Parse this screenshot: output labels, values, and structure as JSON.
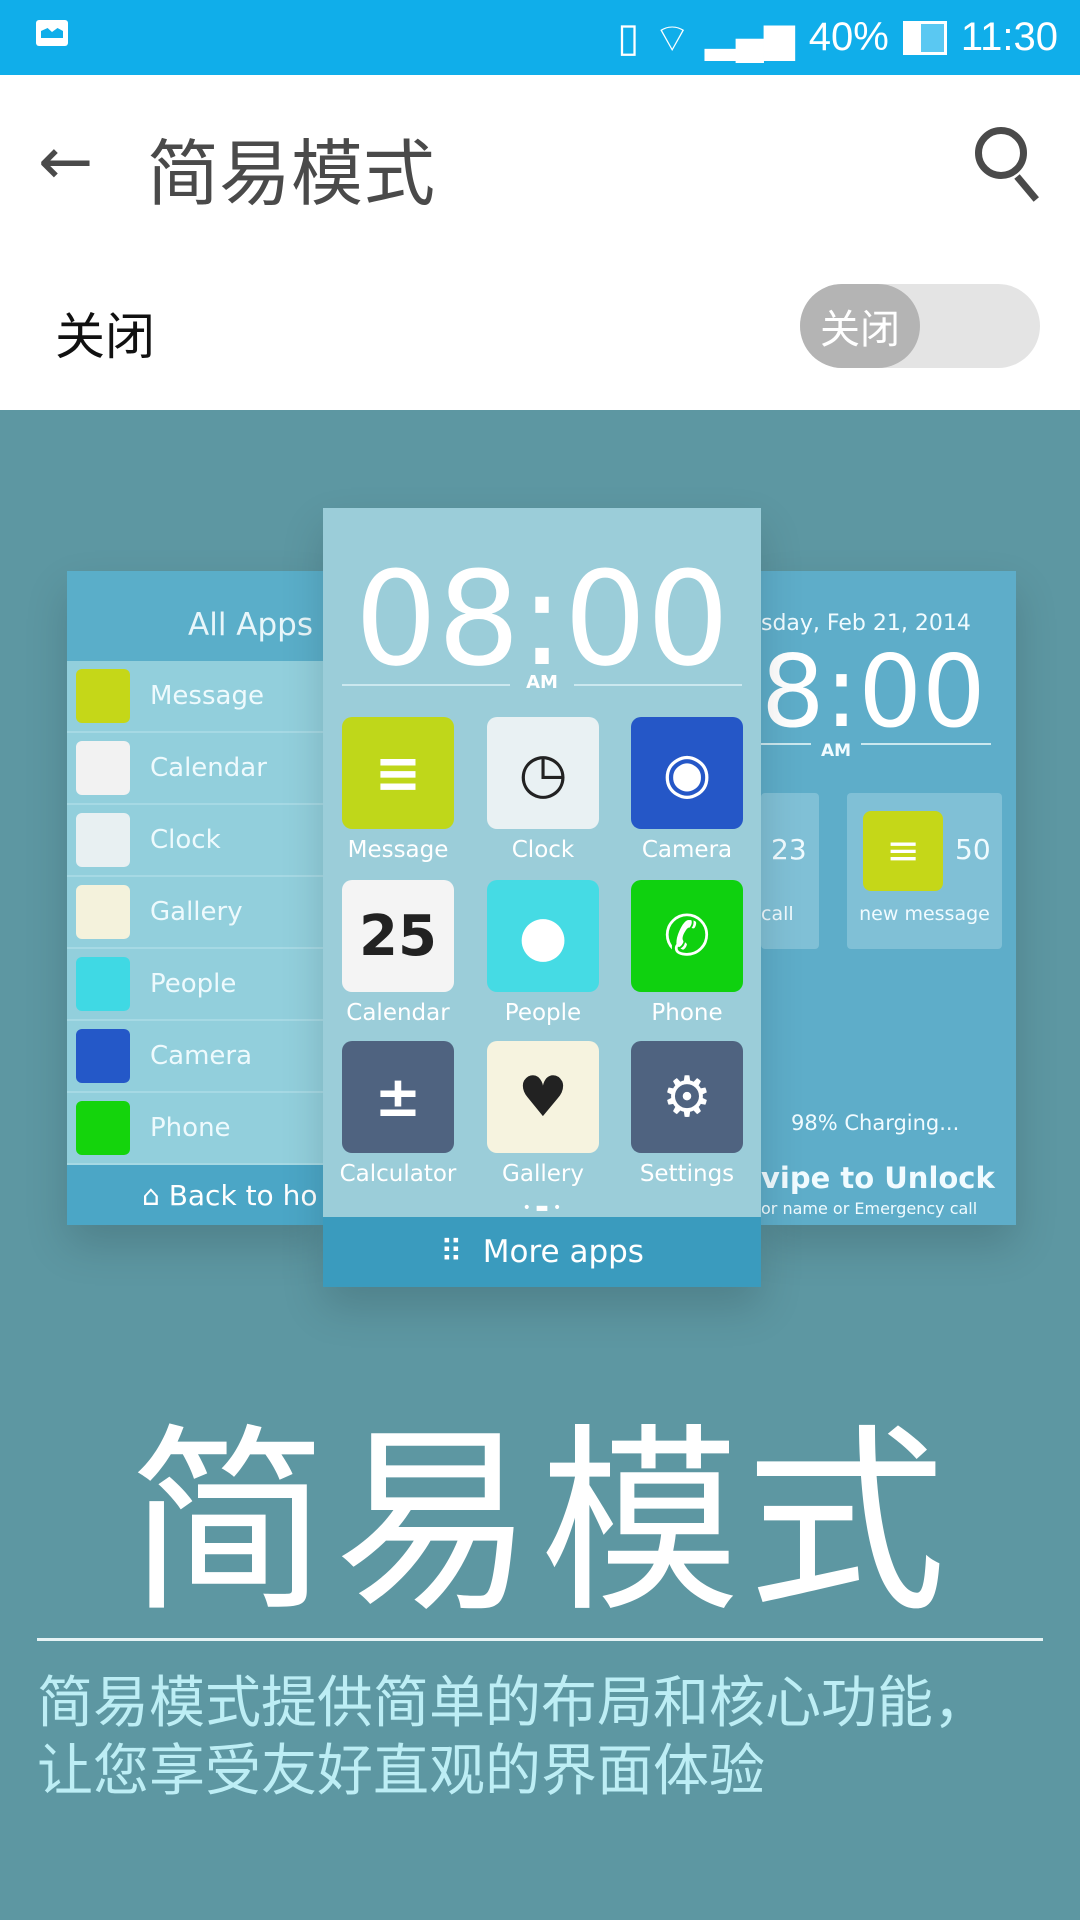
{
  "status_bar": {
    "battery": "40%",
    "time": "11:30",
    "icons": [
      "gallery-notification-icon",
      "vibrate-icon",
      "wifi-icon",
      "signal-icon",
      "battery-icon"
    ]
  },
  "toolbar": {
    "title": "简易模式",
    "back_icon": "arrow-left-icon",
    "search_icon": "search-icon"
  },
  "setting": {
    "label": "关闭",
    "toggle_label": "关闭",
    "toggle_on": false
  },
  "illustration": {
    "left": {
      "header": "All Apps",
      "items": [
        {
          "label": "Message",
          "color": "#c5d718"
        },
        {
          "label": "Calendar",
          "color": "#f2f2f2"
        },
        {
          "label": "Clock",
          "color": "#e8f0f2"
        },
        {
          "label": "Gallery",
          "color": "#f4f2dc"
        },
        {
          "label": "People",
          "color": "#3fd9e4"
        },
        {
          "label": "Camera",
          "color": "#2458c8"
        },
        {
          "label": "Phone",
          "color": "#14d40c"
        }
      ],
      "footer": "Back to ho"
    },
    "center": {
      "time": "08:00",
      "ampm": "AM",
      "apps": [
        {
          "label": "Message",
          "color": "#bfd71a",
          "glyph": "≡"
        },
        {
          "label": "Clock",
          "color": "#e9f1f3",
          "glyph": "◷"
        },
        {
          "label": "Camera",
          "color": "#2557c7",
          "glyph": "◉"
        },
        {
          "label": "Calendar",
          "color": "#f4f4f4",
          "glyph": "25"
        },
        {
          "label": "People",
          "color": "#45dbe4",
          "glyph": "●"
        },
        {
          "label": "Phone",
          "color": "#0fd10f",
          "glyph": "✆"
        },
        {
          "label": "Calculator",
          "color": "#4f6380",
          "glyph": "±"
        },
        {
          "label": "Gallery",
          "color": "#f6f3df",
          "glyph": "♥"
        },
        {
          "label": "Settings",
          "color": "#4f6380",
          "glyph": "⚙"
        }
      ],
      "more_apps": "More apps"
    },
    "right": {
      "date": "sday, Feb 21, 2014",
      "time": "8:00",
      "ampm": "AM",
      "missed_count": "23",
      "missed_label": "call",
      "message_count": "50",
      "message_label": "new message",
      "charging": "98% Charging...",
      "unlock": "vipe to Unlock",
      "unlock_sub": "or name or Emergency call"
    }
  },
  "hero": {
    "title": "简易模式",
    "description": "简易模式提供简单的布局和核心功能，让您享受友好直观的界面体验"
  },
  "colors": {
    "status_bar": "#10aeea",
    "background": "#5d97a2"
  }
}
